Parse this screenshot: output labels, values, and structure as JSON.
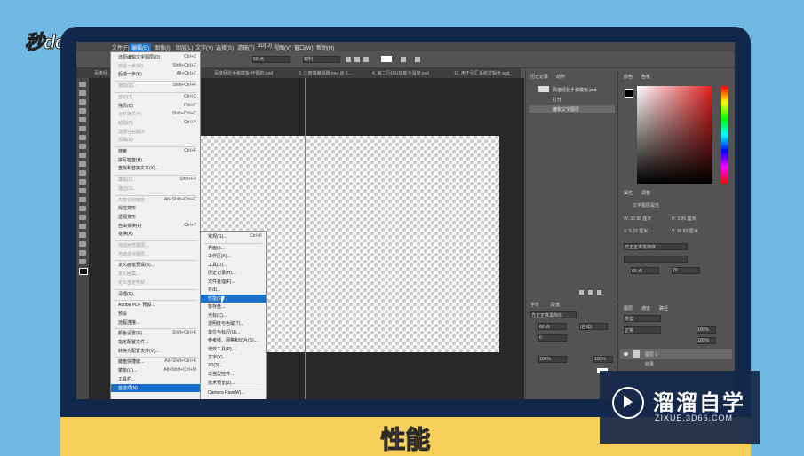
{
  "logo": "秒dong视频",
  "caption": "性能",
  "watermark": {
    "title": "溜溜自学",
    "sub": "ZIXUE.3D66.COM"
  },
  "menubar": [
    "文件(F)",
    "编辑(E)",
    "图像(I)",
    "图层(L)",
    "文字(Y)",
    "选择(S)",
    "滤镜(T)",
    "3D(D)",
    "视图(V)",
    "窗口(W)",
    "帮助(H)"
  ],
  "tabs": [
    "百度经...",
    "百度经验手稿模板-作图的.psd",
    "3_注册填编辑器.psd @ 5...",
    "4_第二行(RU加载卡温度.psd",
    "11_用于引汇系统逻辑全.psd"
  ],
  "options": {
    "size": "60 点",
    "aa": "锐利"
  },
  "edit_menu": [
    {
      "label": "还原编辑文字图层(O)",
      "sc": "Ctrl+Z",
      "dis": false
    },
    {
      "label": "前进一步(W)",
      "sc": "Shift+Ctrl+Z",
      "dis": true
    },
    {
      "label": "后退一步(K)",
      "sc": "Alt+Ctrl+Z",
      "dis": false
    },
    {
      "label": "渐隐(D)...",
      "sc": "Shift+Ctrl+F",
      "dis": true
    },
    {
      "label": "剪切(T)",
      "sc": "Ctrl+X",
      "dis": true
    },
    {
      "label": "拷贝(C)",
      "sc": "Ctrl+C",
      "dis": false
    },
    {
      "label": "合并拷贝(Y)",
      "sc": "Shift+Ctrl+C",
      "dis": true
    },
    {
      "label": "粘贴(P)",
      "sc": "Ctrl+V",
      "dis": true
    },
    {
      "label": "选择性粘贴(I)",
      "sc": "",
      "dis": true
    },
    {
      "label": "清除(E)",
      "sc": "",
      "dis": true
    },
    {
      "label": "搜索",
      "sc": "Ctrl+F",
      "dis": false
    },
    {
      "label": "拼写检查(H)...",
      "sc": "",
      "dis": false
    },
    {
      "label": "查找和替换文本(X)...",
      "sc": "",
      "dis": false
    },
    {
      "label": "填充(L)...",
      "sc": "Shift+F5",
      "dis": true
    },
    {
      "label": "描边(S)...",
      "sc": "",
      "dis": true
    },
    {
      "label": "内容识别缩放",
      "sc": "Alt+Shift+Ctrl+C",
      "dis": true
    },
    {
      "label": "操控变形",
      "sc": "",
      "dis": false
    },
    {
      "label": "透视变形",
      "sc": "",
      "dis": false
    },
    {
      "label": "自由变换(F)",
      "sc": "Ctrl+T",
      "dis": false
    },
    {
      "label": "变换(A)",
      "sc": "",
      "dis": false
    },
    {
      "label": "自动对齐图层...",
      "sc": "",
      "dis": true
    },
    {
      "label": "自动混合图层...",
      "sc": "",
      "dis": true
    },
    {
      "label": "定义画笔预设(B)...",
      "sc": "",
      "dis": false
    },
    {
      "label": "定义图案...",
      "sc": "",
      "dis": true
    },
    {
      "label": "定义自定形状...",
      "sc": "",
      "dis": true
    },
    {
      "label": "清理(R)",
      "sc": "",
      "dis": false
    },
    {
      "label": "Adobe PDF 预设...",
      "sc": "",
      "dis": false
    },
    {
      "label": "预设",
      "sc": "",
      "dis": false
    },
    {
      "label": "远程连接...",
      "sc": "",
      "dis": false
    },
    {
      "label": "颜色设置(G)...",
      "sc": "Shift+Ctrl+K",
      "dis": false
    },
    {
      "label": "指定配置文件...",
      "sc": "",
      "dis": false
    },
    {
      "label": "转换为配置文件(V)...",
      "sc": "",
      "dis": false
    },
    {
      "label": "键盘快捷键...",
      "sc": "Alt+Shift+Ctrl+K",
      "dis": false
    },
    {
      "label": "菜单(U)...",
      "sc": "Alt+Shift+Ctrl+M",
      "dis": false
    },
    {
      "label": "工具栏...",
      "sc": "",
      "dis": false
    },
    {
      "label": "首选项(N)",
      "sc": "",
      "dis": false
    }
  ],
  "pref_menu": [
    {
      "label": "常规(G)...",
      "sc": "Ctrl+K"
    },
    {
      "label": "界面(I)...",
      "sc": ""
    },
    {
      "label": "工作区(K)...",
      "sc": ""
    },
    {
      "label": "工具(O)...",
      "sc": ""
    },
    {
      "label": "历史记录(H)...",
      "sc": ""
    },
    {
      "label": "文件处理(F)...",
      "sc": ""
    },
    {
      "label": "导出...",
      "sc": ""
    },
    {
      "label": "性能(E)...",
      "sc": ""
    },
    {
      "label": "暂存盘...",
      "sc": ""
    },
    {
      "label": "光标(C)...",
      "sc": ""
    },
    {
      "label": "透明度与色域(T)...",
      "sc": ""
    },
    {
      "label": "单位与标尺(U)...",
      "sc": ""
    },
    {
      "label": "参考线、网格和切片(S)...",
      "sc": ""
    },
    {
      "label": "增效工具(P)...",
      "sc": ""
    },
    {
      "label": "文字(Y)...",
      "sc": ""
    },
    {
      "label": "3D(3)...",
      "sc": ""
    },
    {
      "label": "增强型控件...",
      "sc": ""
    },
    {
      "label": "技术预览(Z)...",
      "sc": ""
    },
    {
      "label": "Camera Raw(W)...",
      "sc": ""
    }
  ],
  "history": {
    "tabs": [
      "历史记录",
      "动作"
    ],
    "items": [
      "百度经验手稿模板.psd",
      "打开",
      "编辑文字图层"
    ]
  },
  "color": {
    "tabs": [
      "颜色",
      "色板"
    ]
  },
  "properties": {
    "tabs": [
      "属性",
      "调整"
    ],
    "title": "文字图层属性",
    "w": "W: 37.88 厘米",
    "h": "H: 2.96 厘米",
    "x": "X: 5.32 厘米",
    "y": "Y: 35.83 厘米",
    "font": "方正正准黑简体",
    "size": "60 点",
    "leading": "20"
  },
  "character": {
    "tabs": [
      "字符",
      "段落"
    ],
    "font": "方正正准黑简体",
    "size": "60 点",
    "leading": "(自动)",
    "tracking": "0",
    "scale": "100%",
    "scale2": "100%"
  },
  "layers": {
    "tabs": [
      "图层",
      "通道",
      "路径"
    ],
    "kind": "类型",
    "mode": "正常",
    "opacity": "100%",
    "fill": "100%",
    "layer": "图层 1",
    "effect": "效果"
  }
}
